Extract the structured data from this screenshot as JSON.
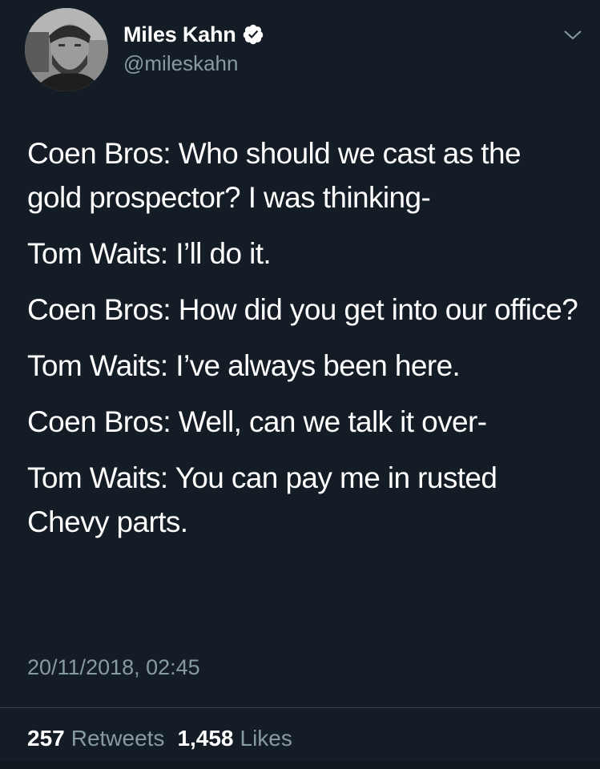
{
  "author": {
    "display_name": "Miles Kahn",
    "handle": "@mileskahn",
    "verified": true
  },
  "tweet": {
    "paragraphs": [
      "Coen Bros: Who should we cast as the gold prospector? I was thinking-",
      "Tom Waits: I’ll do it.",
      "Coen Bros: How did you get into our office?",
      "Tom Waits: I’ve always been here.",
      "Coen Bros: Well, can we talk it over-",
      "Tom Waits: You can pay me in rusted Chevy parts."
    ],
    "timestamp": "20/11/2018, 02:45"
  },
  "stats": {
    "retweets_count": "257",
    "retweets_label": "Retweets",
    "likes_count": "1,458",
    "likes_label": "Likes"
  },
  "icons": {
    "verified": "verified-badge-icon",
    "menu": "chevron-down-icon"
  },
  "colors": {
    "background": "#141d26",
    "text": "#ffffff",
    "secondary_text": "#8899a6",
    "divider": "#38444d"
  }
}
